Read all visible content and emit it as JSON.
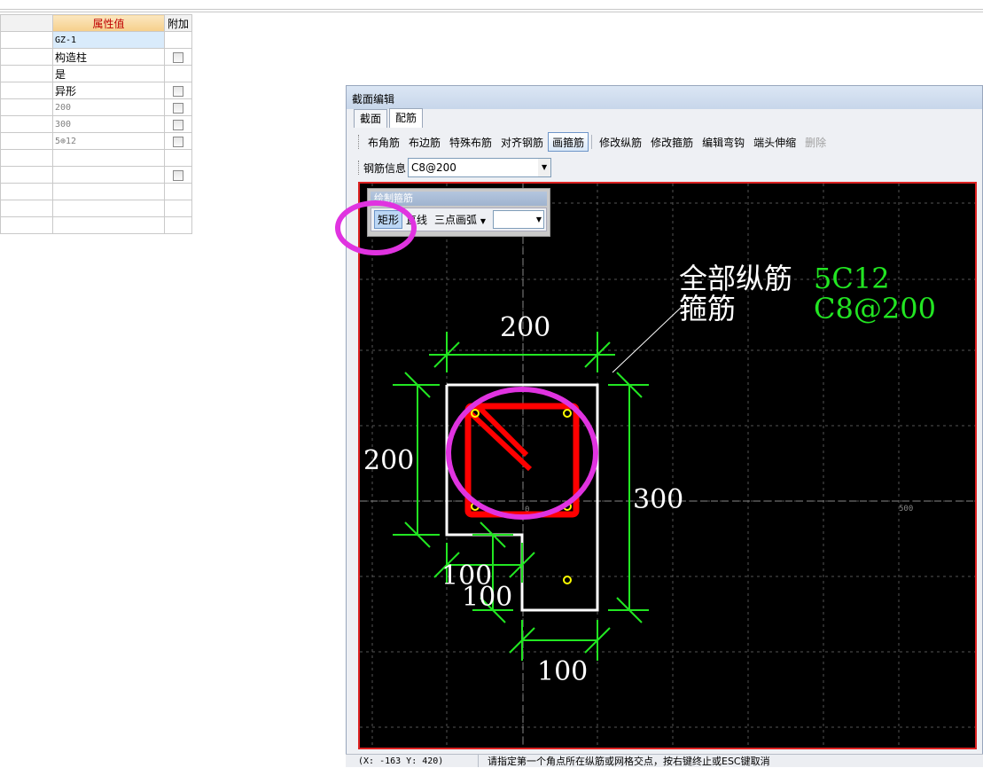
{
  "property_grid": {
    "headers": [
      "",
      "属性值",
      "附加"
    ],
    "rows": [
      {
        "value": "GZ-1",
        "checkbox": false,
        "gray": false
      },
      {
        "value": "构造柱",
        "checkbox": true,
        "gray": false
      },
      {
        "value": "是",
        "checkbox": false,
        "gray": false
      },
      {
        "value": "异形",
        "checkbox": true,
        "gray": false
      },
      {
        "value": "200",
        "checkbox": true,
        "gray": true
      },
      {
        "value": "300",
        "checkbox": true,
        "gray": true
      },
      {
        "value": "5⊕12",
        "checkbox": true,
        "gray": true
      },
      {
        "value": "",
        "checkbox": false,
        "gray": false
      },
      {
        "value": "",
        "checkbox": true,
        "gray": false
      },
      {
        "value": "",
        "checkbox": false,
        "gray": false
      },
      {
        "value": "",
        "checkbox": false,
        "gray": false
      },
      {
        "value": "",
        "checkbox": false,
        "gray": false
      }
    ]
  },
  "editor": {
    "title": "截面编辑",
    "tabs": [
      {
        "label": "截面",
        "active": false
      },
      {
        "label": "配筋",
        "active": true
      }
    ],
    "toolbar": [
      {
        "label": "布角筋",
        "state": ""
      },
      {
        "label": "布边筋",
        "state": ""
      },
      {
        "label": "特殊布筋",
        "state": ""
      },
      {
        "label": "对齐钢筋",
        "state": ""
      },
      {
        "label": "画箍筋",
        "state": "active"
      },
      {
        "label": "修改纵筋",
        "state": ""
      },
      {
        "label": "修改箍筋",
        "state": ""
      },
      {
        "label": "编辑弯钩",
        "state": ""
      },
      {
        "label": "端头伸缩",
        "state": ""
      },
      {
        "label": "删除",
        "state": "disabled"
      }
    ],
    "rebar_info_label": "钢筋信息",
    "rebar_info_value": "C8@200"
  },
  "popup": {
    "title": "绘制箍筋",
    "buttons": {
      "rect": "矩形",
      "line": "直线",
      "arc": "三点画弧"
    },
    "combo_value": ""
  },
  "drawing": {
    "dims": {
      "top_width": "200",
      "left_height": "200",
      "right_height": "300",
      "bottom_width": "100",
      "notch_w": "100",
      "notch_h": "100"
    },
    "legend_line1": "全部纵筋",
    "legend_line2": "箍筋",
    "legend_value1": "5C12",
    "legend_value2": "C8@200",
    "axis_origin": "0",
    "axis_500": "500",
    "colors": {
      "dimension": "#22e622",
      "section": "#ffffff",
      "stirrup": "#ff0000",
      "rebar": "#ffff00",
      "highlight": "#e033e0"
    }
  },
  "status": {
    "coord": "(X: -163 Y: 420)",
    "message": "请指定第一个角点所在纵筋或网格交点，按右键终止或ESC键取消"
  }
}
